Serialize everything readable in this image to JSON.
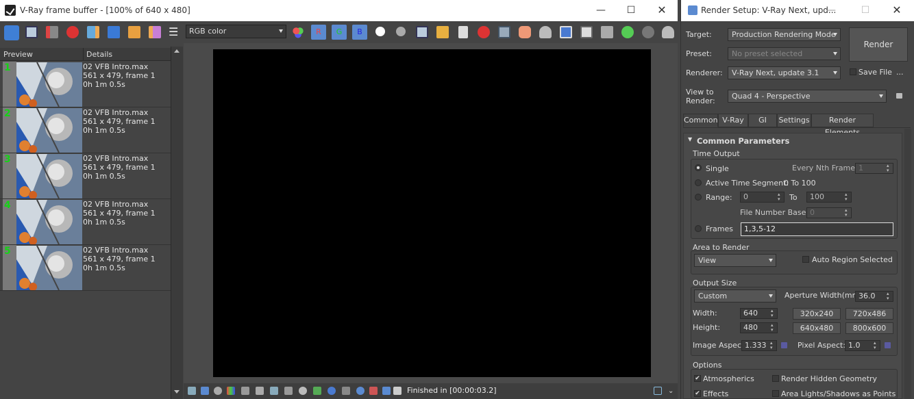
{
  "vfb": {
    "title": "V-Ray frame buffer - [100% of 640 x 480]",
    "channel": "RGB color",
    "history_headers": {
      "preview": "Preview",
      "details": "Details"
    },
    "history": [
      {
        "num": "1",
        "file": "02 VFB Intro.max",
        "res": "561 x 479, frame 1",
        "time": "0h 1m 0.5s"
      },
      {
        "num": "2",
        "file": "02 VFB Intro.max",
        "res": "561 x 479, frame 1",
        "time": "0h 1m 0.5s"
      },
      {
        "num": "3",
        "file": "02 VFB Intro.max",
        "res": "561 x 479, frame 1",
        "time": "0h 1m 0.5s"
      },
      {
        "num": "4",
        "file": "02 VFB Intro.max",
        "res": "561 x 479, frame 1",
        "time": "0h 1m 0.5s"
      },
      {
        "num": "5",
        "file": "02 VFB Intro.max",
        "res": "561 x 479, frame 1",
        "time": "0h 1m 0.5s"
      }
    ],
    "status": "Finished in [00:00:03.2]",
    "channel_buttons": {
      "r": "R",
      "g": "G",
      "b": "B"
    }
  },
  "render_setup": {
    "title": "Render Setup: V-Ray Next, upd...",
    "target_label": "Target:",
    "target": "Production Rendering Mode",
    "preset_label": "Preset:",
    "preset": "No preset selected",
    "renderer_label": "Renderer:",
    "renderer": "V-Ray Next, update 3.1",
    "save_file": "Save File",
    "view_label": "View to Render:",
    "view": "Quad 4 - Perspective",
    "render_button": "Render",
    "more": "...",
    "tabs": [
      "Common",
      "V-Ray",
      "GI",
      "Settings",
      "Render Elements"
    ],
    "rollout": "Common Parameters",
    "time_output": {
      "title": "Time Output",
      "single": "Single",
      "every_nth": "Every Nth Frame:",
      "every_nth_val": "1",
      "active_segment": "Active Time Segment:",
      "active_range": "0 To 100",
      "range": "Range:",
      "range_from": "0",
      "to": "To",
      "range_to": "100",
      "file_number_base": "File Number Base:",
      "file_number_val": "0",
      "frames": "Frames",
      "frames_val": "1,3,5-12"
    },
    "area": {
      "title": "Area to Render",
      "mode": "View",
      "auto_region": "Auto Region Selected"
    },
    "output_size": {
      "title": "Output Size",
      "preset": "Custom",
      "aperture_label": "Aperture Width(mm):",
      "aperture": "36.0",
      "width_label": "Width:",
      "width": "640",
      "height_label": "Height:",
      "height": "480",
      "sizes": [
        "320x240",
        "720x486",
        "640x480",
        "800x600"
      ],
      "image_aspect_label": "Image Aspect:",
      "image_aspect": "1.333",
      "pixel_aspect_label": "Pixel Aspect:",
      "pixel_aspect": "1.0"
    },
    "options": {
      "title": "Options",
      "atmospherics": "Atmospherics",
      "hidden_geo": "Render Hidden Geometry",
      "effects": "Effects",
      "area_lights": "Area Lights/Shadows as Points"
    }
  },
  "colors": {
    "accent": "#16d316",
    "canvas": "#000000",
    "bg": "#444444"
  }
}
